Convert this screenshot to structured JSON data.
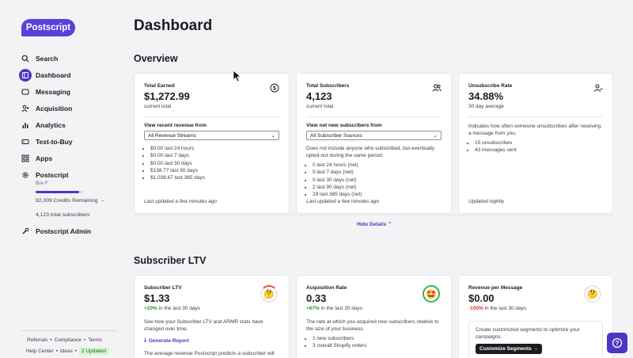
{
  "app": {
    "logo": "Postscript"
  },
  "sidebar": {
    "items": [
      {
        "label": "Search",
        "icon": "search-icon"
      },
      {
        "label": "Dashboard",
        "icon": "dashboard-icon",
        "active": true
      },
      {
        "label": "Messaging",
        "icon": "message-icon"
      },
      {
        "label": "Acquisition",
        "icon": "user-add-icon"
      },
      {
        "label": "Analytics",
        "icon": "bar-chart-icon"
      },
      {
        "label": "Text-to-Buy",
        "icon": "tag-icon"
      },
      {
        "label": "Apps",
        "icon": "apps-icon"
      }
    ],
    "org": {
      "name": "Postscript",
      "user": "Bre F",
      "credits": "92,009 Credits Remaining →",
      "credits_fraction": 0.92,
      "subscribers": "4,123 total subscribers"
    },
    "admin": "Postscript Admin",
    "footer": {
      "referrals": "Referrals",
      "compliance": "Compliance",
      "terms": "Terms",
      "help": "Help Center",
      "ideas": "Ideas",
      "updates": "2 Updates!"
    }
  },
  "page": {
    "title": "Dashboard"
  },
  "overview": {
    "title": "Overview",
    "cards": [
      {
        "label": "Total Earned",
        "value": "$1,272.99",
        "sub": "current total",
        "field_label": "View recent revenue from",
        "select": "All Revenue Streams",
        "stats": [
          "$0.00 last 24 hours",
          "$0.00 last 7 days",
          "$0.00 last 30 days",
          "$138.77 last 90 days",
          "$1,038.67 last 365 days"
        ],
        "footer": "Last updated a few minutes ago"
      },
      {
        "label": "Total Subscribers",
        "value": "4,123",
        "sub": "current total",
        "field_label": "View net new subscribers from",
        "select": "All Subscriber Sources",
        "desc": "Does not include anyone who subscribed, but eventually opted-out during the same period.",
        "stats": [
          "0 last 24 hours (net)",
          "0 last 7 days (net)",
          "0 last 30 days (net)",
          "2 last 90 days (net)",
          "29 last 365 days (net)"
        ],
        "footer": "Last updated a few minutes ago"
      },
      {
        "label": "Unsubscribe Rate",
        "value": "34.88%",
        "sub": "30 day average",
        "desc": "Indicates how often someone unsubscribes after receiving a message from you.",
        "stats": [
          "15 unsubscribes",
          "43 messages sent"
        ],
        "footer": "Updated nightly"
      }
    ],
    "hide_details": "Hide Details"
  },
  "ltv": {
    "title": "Subscriber LTV",
    "cards": [
      {
        "label": "Subscriber LTV",
        "value": "$1.33",
        "change": "+20%",
        "change_text": " in the last 30 days",
        "desc": "See how your Subscriber LTV and ARMR stats have changed over time.",
        "link": "Generate Report",
        "desc2": "The average revenue Postscript predicts a subscriber will"
      },
      {
        "label": "Acquisition Rate",
        "value": "0.33",
        "change": "+67%",
        "change_text": " in the last 30 days",
        "desc": "The rate at which you acquired new subscribers relative to the size of your business.",
        "stats": [
          "1 new subscribers",
          "3 overall Shopify orders"
        ]
      },
      {
        "label": "Revenue per Message",
        "value": "$0.00",
        "change": "-100%",
        "change_text": " in the last 30 days",
        "seg_text": "Create customized segments to optimize your campaigns.",
        "seg_button": "Customize Segments →"
      }
    ]
  },
  "colors": {
    "accent": "#4c35c4",
    "positive": "#1e9b3a",
    "negative": "#d63b2d"
  }
}
